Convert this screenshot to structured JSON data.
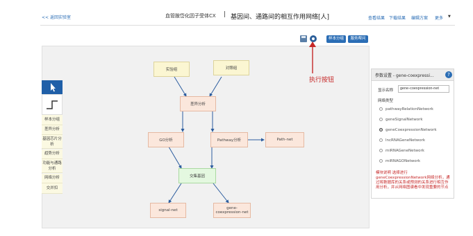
{
  "header": {
    "back_link": "<< 返回实验室",
    "title_left": "血管胺岱化因子受体CX",
    "title_sep": "|",
    "title_main": "基因间、通路间的相互作用网络[人]",
    "nav": [
      "查看结果",
      "下载结果",
      "编辑方案",
      "更多"
    ]
  },
  "toolbar": {
    "save_icon": "save-icon",
    "run_icon": "gear-icon",
    "buttons": [
      "样本分组",
      "服务帮问"
    ]
  },
  "palette": {
    "pointer_icon": "pointer-icon",
    "step_icon": "step-icon",
    "items": [
      "样本分组",
      "差异分析",
      "基因芯片分析",
      "趋势分析",
      "功能与通路分析",
      "网络分析",
      "交并扣"
    ]
  },
  "workflow": {
    "nodes": {
      "experiment": "实验组",
      "control": "对照组",
      "diff": "差异分析",
      "go": "GO分析",
      "pathway": "Pathway分析",
      "pathnet": "Path-net",
      "intersect": "交集基因",
      "signalnet": "signal-net",
      "coexpnet": "gene-coexpression-net"
    }
  },
  "annotation": "执行按钮",
  "panel": {
    "title": "参数设置 - gene-coexpressi...",
    "help_icon": "?",
    "name_label": "显示名称",
    "name_value": "gene-coexpression-net",
    "type_label": "网络类型",
    "options": [
      "pathwayRelationNetwork",
      "geneSignalNetwork",
      "geneCoexpressionNetwork",
      "lncRNAGeneNetwork",
      "miRNAGeneNetwork",
      "miRNAGONetwork"
    ],
    "selected_index": 2,
    "description": "模块说明 选择进行geneCoexpressionNetwork网络分析，通过将数据库的关系或预测的关系进行相互作用分析，并从网络图谱看中发现重要的节点"
  },
  "colors": {
    "link": "#2a6db5",
    "annotation": "#c62828",
    "arrow": "#2b5c9e"
  }
}
